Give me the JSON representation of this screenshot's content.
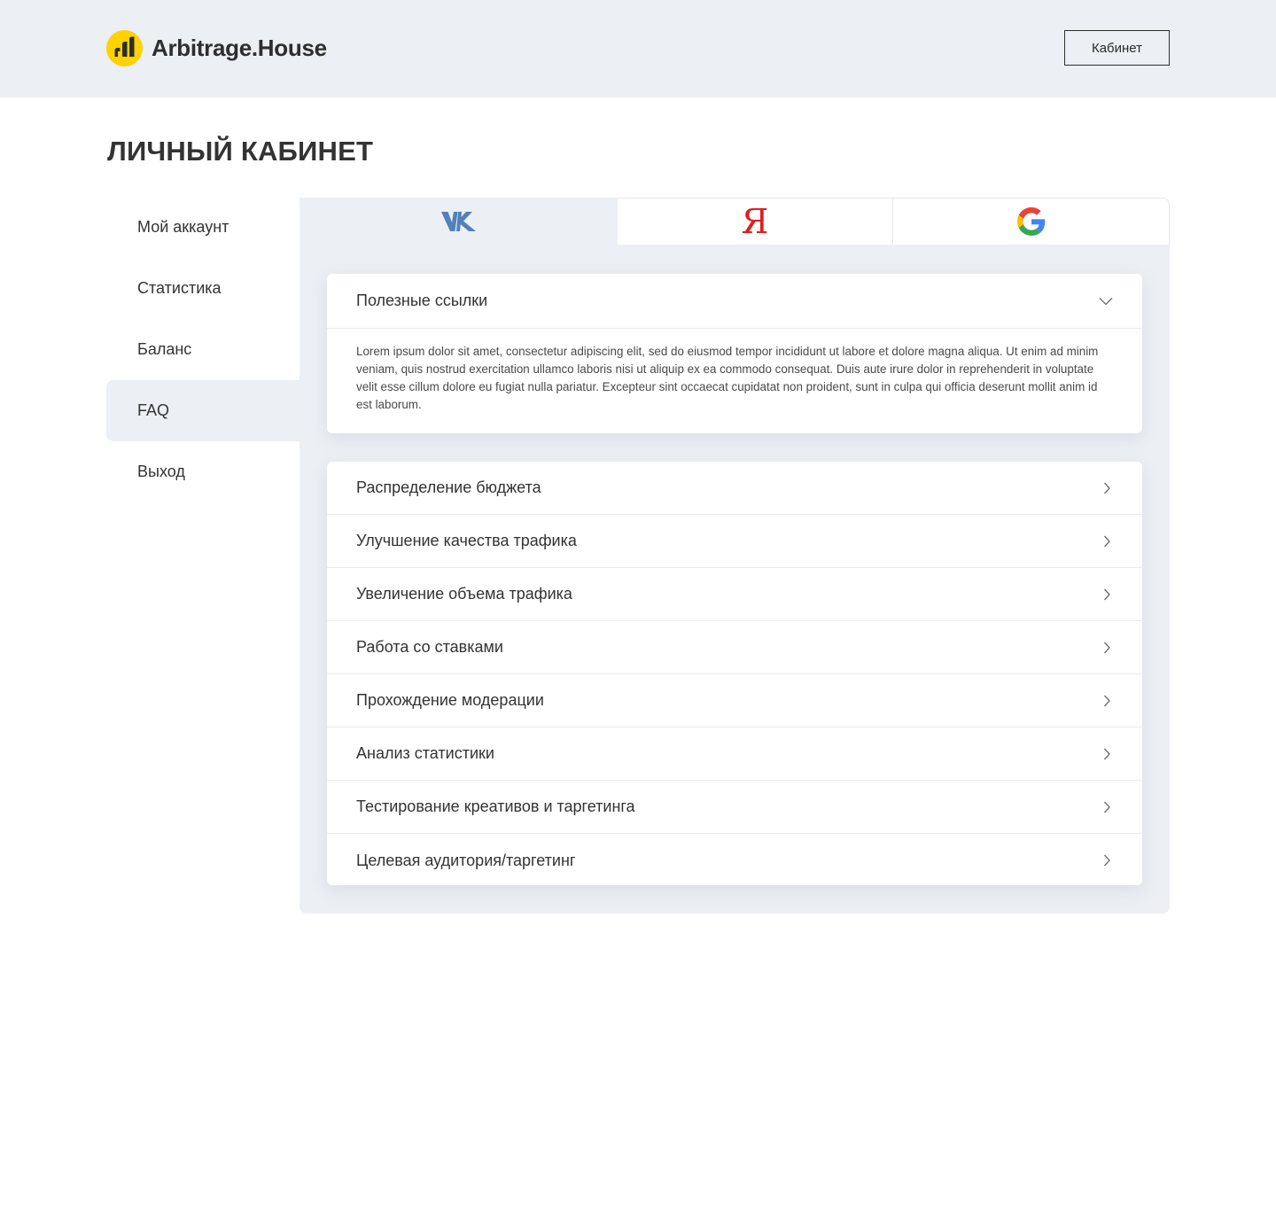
{
  "header": {
    "brand": "Arbitrage.House",
    "cabinet_button": "Кабинет",
    "colors": {
      "background": "#eceff3",
      "logo_yellow": "#ffd200"
    }
  },
  "page_title": "ЛИЧНЫЙ КАБИНЕТ",
  "sidebar": {
    "items": [
      {
        "label": "Мой аккаунт",
        "active": false
      },
      {
        "label": "Статистика",
        "active": false
      },
      {
        "label": "Баланс",
        "active": false
      },
      {
        "label": "FAQ",
        "active": true
      },
      {
        "label": "Выход",
        "active": false
      }
    ]
  },
  "tabs": [
    {
      "icon": "vk-logo-icon",
      "active": true
    },
    {
      "icon": "yandex-logo-icon",
      "glyph": "Я",
      "active": false
    },
    {
      "icon": "google-logo-icon",
      "active": false
    }
  ],
  "faq": {
    "open_item": {
      "title": "Полезные ссылки",
      "icon": "chevron-down-icon",
      "body": "Lorem ipsum dolor sit amet, consectetur adipiscing elit, sed do eiusmod tempor incididunt ut labore et dolore magna aliqua. Ut enim ad minim veniam, quis nostrud exercitation ullamco laboris nisi ut aliquip ex ea commodo consequat. Duis aute irure dolor in reprehenderit in voluptate velit esse cillum dolore eu fugiat nulla pariatur. Excepteur sint occaecat cupidatat non proident, sunt in culpa qui officia deserunt mollit anim id est laborum."
    },
    "items": [
      "Распределение бюджета",
      "Улучшение качества трафика",
      "Увеличение объема трафика",
      "Работа со ставками",
      "Прохождение модерации",
      "Анализ статистики",
      "Тестирование креативов и таргетинга",
      "Целевая аудитория/таргетинг"
    ],
    "item_icon": "chevron-right-icon"
  }
}
